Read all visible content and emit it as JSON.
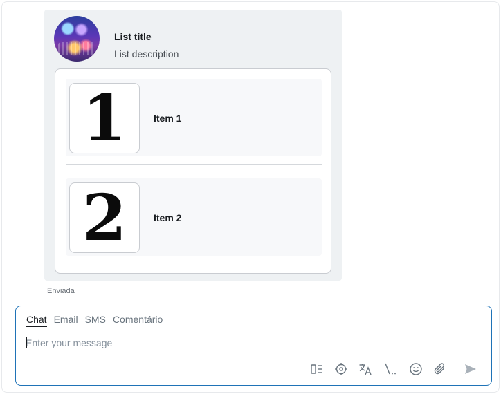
{
  "message": {
    "list_title": "List title",
    "list_description": "List description",
    "items": [
      {
        "glyph": "1",
        "label": "Item 1"
      },
      {
        "glyph": "2",
        "label": "Item 2"
      }
    ],
    "status": "Enviada"
  },
  "composer": {
    "tabs": [
      "Chat",
      "Email",
      "SMS",
      "Comentário"
    ],
    "active_tab": "Chat",
    "placeholder": "Enter your message",
    "value": "",
    "toolbar_icons": [
      "insert-template-icon",
      "crosshair-icon",
      "translate-icon",
      "macro-icon",
      "emoji-icon",
      "attachment-icon",
      "send-icon"
    ]
  },
  "colors": {
    "accent": "#1f73b7",
    "card_bg": "#eef1f3",
    "icon": "#68737d"
  }
}
